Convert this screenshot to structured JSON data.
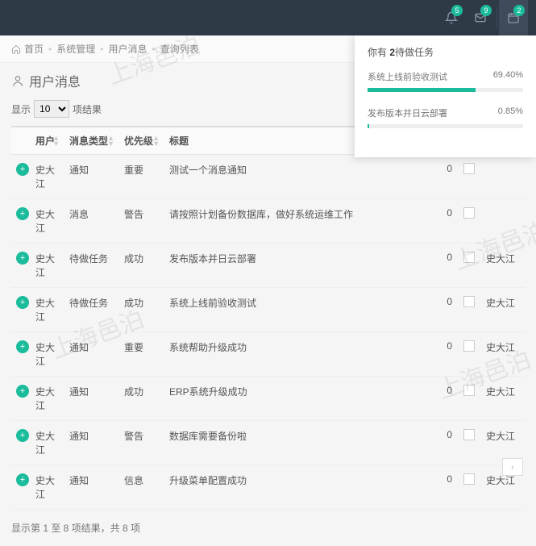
{
  "watermark_text": "上海邑泊",
  "topbar": {
    "badges": [
      "5",
      "9",
      "2"
    ]
  },
  "breadcrumb": {
    "home": "首页",
    "items": [
      "系统管理",
      "用户消息",
      "查询列表"
    ]
  },
  "page_title": "用户消息",
  "show": {
    "label_prefix": "显示",
    "value": "10",
    "label_suffix": "项结果"
  },
  "columns": [
    "用户",
    "消息类型",
    "优先级",
    "标题"
  ],
  "rows": [
    {
      "user": "史大江",
      "type": "通知",
      "priority": "重要",
      "title": "测试一个消息通知",
      "num": "0",
      "owner": ""
    },
    {
      "user": "史大江",
      "type": "消息",
      "priority": "警告",
      "title": "请按照计划备份数据库，做好系统运维工作",
      "num": "0",
      "owner": ""
    },
    {
      "user": "史大江",
      "type": "待做任务",
      "priority": "成功",
      "title": "发布版本并日云部署",
      "num": "0",
      "owner": "史大江"
    },
    {
      "user": "史大江",
      "type": "待做任务",
      "priority": "成功",
      "title": "系统上线前验收测试",
      "num": "0",
      "owner": "史大江"
    },
    {
      "user": "史大江",
      "type": "通知",
      "priority": "重要",
      "title": "系统帮助升级成功",
      "num": "0",
      "owner": "史大江"
    },
    {
      "user": "史大江",
      "type": "通知",
      "priority": "成功",
      "title": "ERP系统升级成功",
      "num": "0",
      "owner": "史大江"
    },
    {
      "user": "史大江",
      "type": "通知",
      "priority": "警告",
      "title": "数据库需要备份啦",
      "num": "0",
      "owner": "史大江"
    },
    {
      "user": "史大江",
      "type": "通知",
      "priority": "信息",
      "title": "升级菜单配置成功",
      "num": "0",
      "owner": "史大江"
    }
  ],
  "footer_info": "显示第 1 至 8 项结果，共 8 项",
  "task_panel": {
    "prefix": "你有 ",
    "count": "2",
    "suffix": "待做任务",
    "tasks": [
      {
        "name": "系统上线前验收测试",
        "pct": "69.40%",
        "bar": 69.4
      },
      {
        "name": "发布版本并日云部署",
        "pct": "0.85%",
        "bar": 0.85
      }
    ]
  }
}
